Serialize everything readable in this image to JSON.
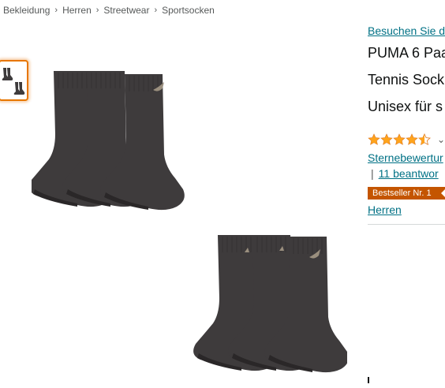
{
  "breadcrumb": {
    "items": [
      "Bekleidung",
      "Herren",
      "Streetwear",
      "Sportsocken"
    ],
    "separator": "›"
  },
  "product": {
    "store_link": "Besuchen Sie de",
    "title_lines": [
      "PUMA 6 Paa",
      "Tennis Sock",
      "Unisex für s"
    ],
    "rating": {
      "stars": 4.5,
      "max": 5
    },
    "rating_text": "Sternebewertur",
    "answered_text": "11 beantwor",
    "bestseller_badge": "Bestseller Nr. 1",
    "category": "Herren"
  },
  "colors": {
    "link": "#007185",
    "badge": "#c45500",
    "star": "#ffa41c",
    "thumb_border": "#e77600",
    "sock": "#3e3b3c"
  },
  "icons": {
    "rating_chevron": "chevron-down-icon"
  }
}
